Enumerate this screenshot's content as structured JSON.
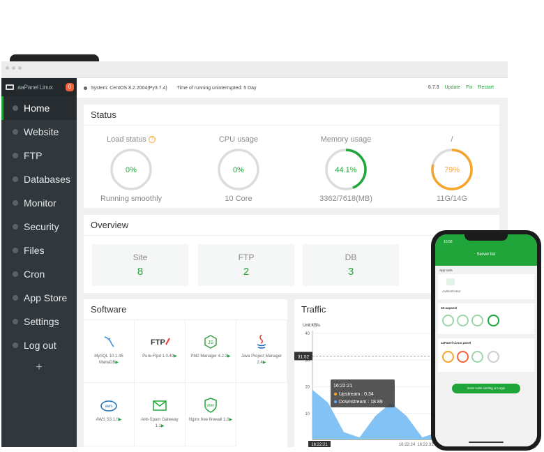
{
  "sidebar": {
    "brand_text": "aaPanel Linux",
    "brand_badge": "0",
    "items": [
      {
        "label": "Home",
        "icon": "home-icon",
        "active": true
      },
      {
        "label": "Website",
        "icon": "globe-icon"
      },
      {
        "label": "FTP",
        "icon": "ftp-icon"
      },
      {
        "label": "Databases",
        "icon": "database-icon"
      },
      {
        "label": "Monitor",
        "icon": "monitor-icon"
      },
      {
        "label": "Security",
        "icon": "shield-icon"
      },
      {
        "label": "Files",
        "icon": "folder-icon"
      },
      {
        "label": "Cron",
        "icon": "clock-icon"
      },
      {
        "label": "App Store",
        "icon": "grid-icon"
      },
      {
        "label": "Settings",
        "icon": "gear-icon"
      },
      {
        "label": "Log out",
        "icon": "logout-icon"
      }
    ],
    "add_label": "+"
  },
  "statusbar": {
    "system": "System:  CentOS 8.2.2004(Py3.7.4)",
    "uptime": "Time of running uninterrupted: 5 Day",
    "version": "6.7.3",
    "update": "Update",
    "fix": "Fix",
    "restart": "Restart"
  },
  "status": {
    "title": "Status",
    "gauges": [
      {
        "label": "Load status",
        "value": "0%",
        "sub": "Running smoothly",
        "fraction": 0,
        "color": "#20a53a"
      },
      {
        "label": "CPU usage",
        "value": "0%",
        "sub": "10 Core",
        "fraction": 0,
        "color": "#20a53a"
      },
      {
        "label": "Memory usage",
        "value": "44.1%",
        "sub": "3362/7618(MB)",
        "fraction": 0.441,
        "color": "#20a53a"
      },
      {
        "label": "/",
        "value": "79%",
        "sub": "11G/14G",
        "fraction": 0.79,
        "color": "#f7a42b"
      }
    ]
  },
  "overview": {
    "title": "Overview",
    "cards": [
      {
        "label": "Site",
        "value": "8"
      },
      {
        "label": "FTP",
        "value": "2"
      },
      {
        "label": "DB",
        "value": "3"
      }
    ]
  },
  "software": {
    "title": "Software",
    "items": [
      {
        "name": "MySQL 10.1.45 MariaDB",
        "icon": "dolphin-icon"
      },
      {
        "name": "Pure-Ftpd 1.0.49",
        "icon": "ftp-logo-icon"
      },
      {
        "name": "PM2 Manager 4.2.3",
        "icon": "nodejs-icon"
      },
      {
        "name": "Java Project Manager 2.4",
        "icon": "java-icon"
      },
      {
        "name": "AWS S3 1.0",
        "icon": "aws-icon"
      },
      {
        "name": "Anti-Spam Gateway 1.1",
        "icon": "mail-icon"
      },
      {
        "name": "Nginx free firewall 1.0",
        "icon": "waf-icon"
      }
    ]
  },
  "traffic": {
    "title": "Traffic",
    "unit": "Unit:KB/s",
    "marker": "31.52",
    "tooltip": {
      "time": "16:22:21",
      "up": "Upstream : 0.34",
      "down": "Downstream : 18.89"
    }
  },
  "chart_data": {
    "type": "area",
    "ylabel": "Unit:KB/s",
    "yticks": [
      10,
      20,
      30,
      40
    ],
    "ylim": [
      0,
      40
    ],
    "x": [
      "16:22:21",
      "16:22:22",
      "16:22:23",
      "16:22:24",
      "16:22:25",
      "16:22:26",
      "16:22:27",
      "16:22:28",
      "16:22:29",
      "16:22:30",
      "16:22:31",
      "16:22:32",
      "16:22:33"
    ],
    "xtick_labels": [
      "16:22:21",
      "16:22:24",
      "16:22:33"
    ],
    "series": [
      {
        "name": "Downstream",
        "values": [
          18.89,
          14,
          3,
          1,
          9,
          14,
          9,
          1,
          3,
          8,
          4,
          1,
          1
        ],
        "color": "#5aaef2"
      },
      {
        "name": "Upstream",
        "values": [
          0.34,
          0.3,
          0.2,
          0.2,
          0.3,
          0.3,
          0.2,
          0.2,
          0.2,
          0.2,
          0.2,
          0.2,
          0.2
        ],
        "color": "#f7a42b"
      }
    ]
  },
  "phone": {
    "time": "10:58",
    "title": "Server list",
    "app_tools": "App tools",
    "authenticator": "Authenticator",
    "server1": "49-aapanel",
    "server2": "aaPanel Linux panel",
    "button": "Scan code binding or Login"
  }
}
